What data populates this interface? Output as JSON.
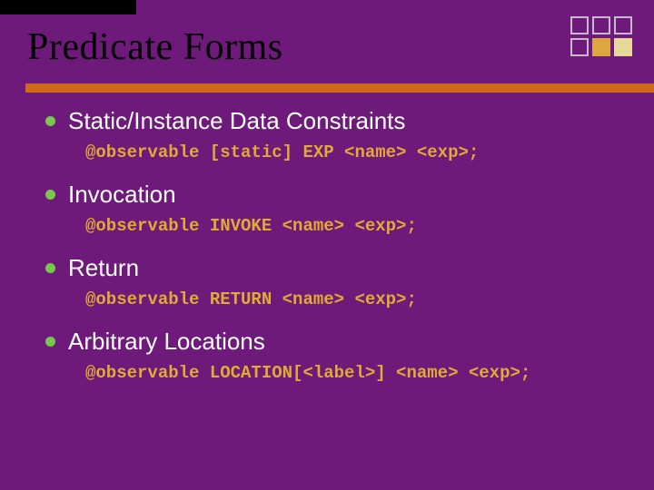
{
  "title": "Predicate Forms",
  "items": [
    {
      "heading": "Static/Instance Data Constraints",
      "code": "@observable [static] EXP <name> <exp>;"
    },
    {
      "heading": "Invocation",
      "code": "@observable INVOKE <name> <exp>;"
    },
    {
      "heading": "Return",
      "code": "@observable RETURN <name> <exp>;"
    },
    {
      "heading": "Arbitrary Locations",
      "code": "@observable LOCATION[<label>] <name> <exp>;"
    }
  ]
}
